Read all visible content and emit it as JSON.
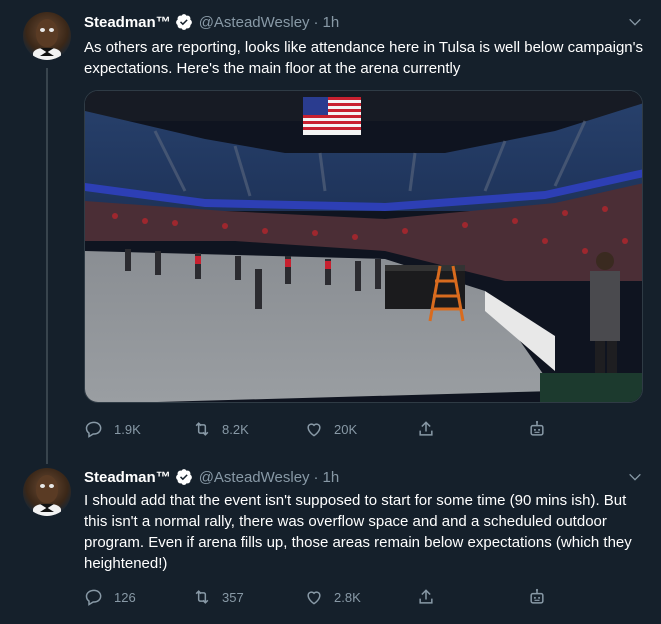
{
  "tweets": [
    {
      "name": "Steadman™",
      "handle": "@AsteadWesley",
      "separator": "·",
      "time": "1h",
      "text": "As others are reporting, looks like attendance here in Tulsa is well below campaign's expectations. Here's the main floor at the arena currently",
      "replies": "1.9K",
      "retweets": "8.2K",
      "likes": "20K"
    },
    {
      "name": "Steadman™",
      "handle": "@AsteadWesley",
      "separator": "·",
      "time": "1h",
      "text": "I should add that the event isn't supposed to start for some time (90 mins ish). But this isn't a normal rally, there was overflow space and and a scheduled outdoor program. Even if arena fills up, those areas remain below expectations (which they heightened!)",
      "replies": "126",
      "retweets": "357",
      "likes": "2.8K"
    }
  ],
  "icons": {
    "verified": "verified-badge-icon",
    "caret": "chevron-down-icon",
    "reply": "reply-icon",
    "retweet": "retweet-icon",
    "like": "heart-icon",
    "share": "share-icon",
    "analytics": "bot-analytics-icon"
  },
  "colors": {
    "background": "#15202b",
    "secondary_text": "#8899a6",
    "divider": "#38444d",
    "verified_badge": "#ffffff"
  }
}
